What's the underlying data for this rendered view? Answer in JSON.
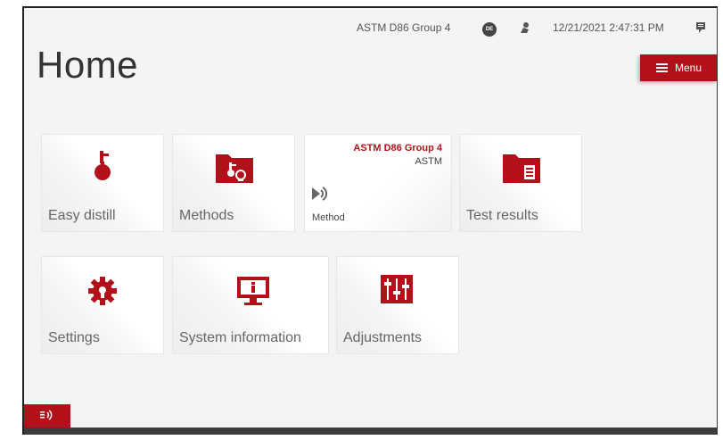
{
  "status": {
    "method_name": "ASTM D86 Group 4",
    "language_badge": "DE",
    "user_icon": "user-icon",
    "datetime": "12/21/2021 2:47:31 PM",
    "messages_icon": "messages-icon"
  },
  "page": {
    "title": "Home"
  },
  "menu": {
    "label": "Menu",
    "icon": "hamburger-icon"
  },
  "tiles": {
    "easy_distill": {
      "label": "Easy distill",
      "icon": "flask-icon"
    },
    "methods": {
      "label": "Methods",
      "icon": "methods-folder-icon"
    },
    "current_method": {
      "title": "ASTM D86 Group 4",
      "subtitle": "ASTM",
      "label": "Method",
      "icon": "play-method-icon"
    },
    "test_results": {
      "label": "Test results",
      "icon": "results-folder-icon"
    },
    "settings": {
      "label": "Settings",
      "icon": "gear-icon"
    },
    "system_information": {
      "label": "System information",
      "icon": "monitor-info-icon"
    },
    "adjustments": {
      "label": "Adjustments",
      "icon": "sliders-icon"
    }
  },
  "colors": {
    "accent": "#b3111a",
    "background": "#f4f4f4",
    "bottom_bar": "#3b3b3b"
  }
}
